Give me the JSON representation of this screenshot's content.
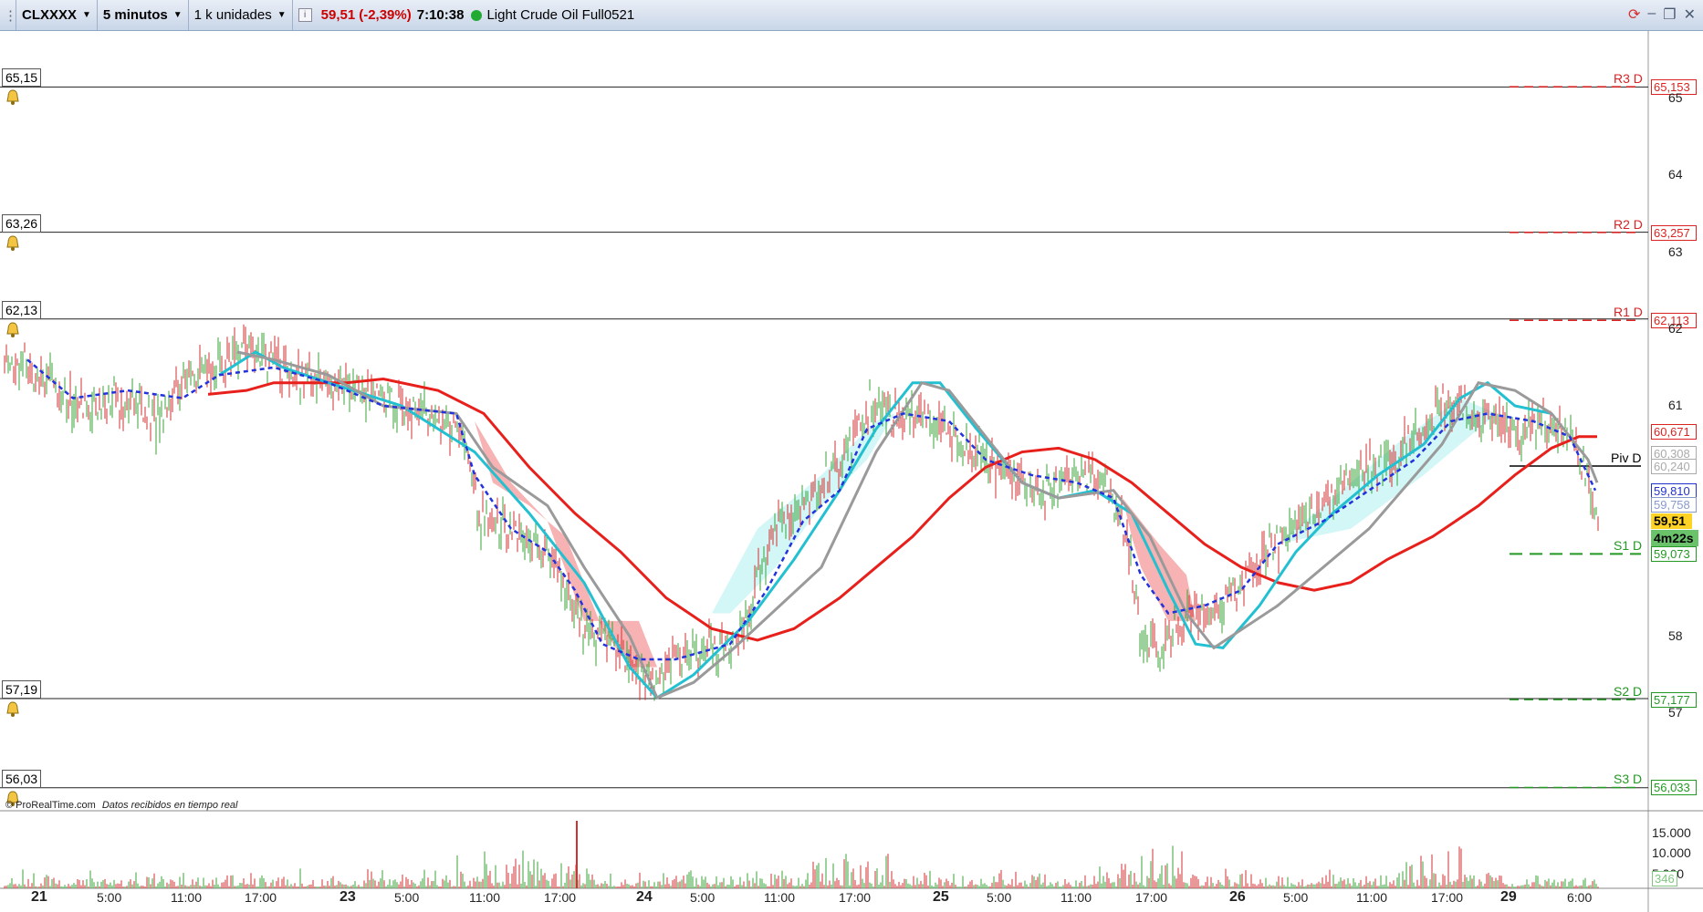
{
  "toolbar": {
    "symbol": "CLXXXX",
    "timeframe": "5 minutos",
    "units": "1 k unidades",
    "info_icon": "info-icon",
    "price": "59,51",
    "change": "(-2,39%)",
    "clock": "7:10:38",
    "instrument": "Light Crude Oil Full0521"
  },
  "window_controls": [
    "sync-icon",
    "minimize-icon",
    "restore-icon",
    "close-icon"
  ],
  "alerts": [
    {
      "label": "65,15",
      "price": 65.15
    },
    {
      "label": "63,26",
      "price": 63.26
    },
    {
      "label": "62,13",
      "price": 62.13
    },
    {
      "label": "57,19",
      "price": 57.19
    },
    {
      "label": "56,03",
      "price": 56.03
    }
  ],
  "pivots": [
    {
      "name": "R3 D",
      "value": "65,153",
      "price": 65.153,
      "color": "#dd2222"
    },
    {
      "name": "R2 D",
      "value": "63,257",
      "price": 63.257,
      "color": "#dd2222"
    },
    {
      "name": "R1 D",
      "value": "62,113",
      "price": 62.113,
      "color": "#dd2222"
    },
    {
      "name": "Piv D",
      "value": "60,217",
      "price": 60.217,
      "color": "#000000"
    },
    {
      "name": "S1 D",
      "value": "59,073",
      "price": 59.073,
      "color": "#229922"
    },
    {
      "name": "S2 D",
      "value": "57,177",
      "price": 57.177,
      "color": "#229922"
    },
    {
      "name": "S3 D",
      "value": "56,033",
      "price": 56.033,
      "color": "#229922"
    }
  ],
  "price_axis": [
    "65",
    "64",
    "63",
    "62",
    "61",
    "58",
    "57"
  ],
  "indicator_values": [
    {
      "value": "60,671",
      "color": "#dd2222"
    },
    {
      "value": "60,308",
      "color": "#aaaaaa"
    },
    {
      "value": "60,240",
      "color": "#aaaaaa"
    },
    {
      "value": "59,810",
      "color": "#2233cc"
    },
    {
      "value": "59,758",
      "color": "#8899cc"
    }
  ],
  "current_price": "59,51",
  "countdown": "4m22s",
  "time_axis": [
    {
      "label": "21",
      "day": true
    },
    {
      "label": "5:00",
      "day": false
    },
    {
      "label": "11:00",
      "day": false
    },
    {
      "label": "17:00",
      "day": false
    },
    {
      "label": "23",
      "day": true
    },
    {
      "label": "5:00",
      "day": false
    },
    {
      "label": "11:00",
      "day": false
    },
    {
      "label": "17:00",
      "day": false
    },
    {
      "label": "24",
      "day": true
    },
    {
      "label": "5:00",
      "day": false
    },
    {
      "label": "11:00",
      "day": false
    },
    {
      "label": "17:00",
      "day": false
    },
    {
      "label": "25",
      "day": true
    },
    {
      "label": "5:00",
      "day": false
    },
    {
      "label": "11:00",
      "day": false
    },
    {
      "label": "17:00",
      "day": false
    },
    {
      "label": "26",
      "day": true
    },
    {
      "label": "5:00",
      "day": false
    },
    {
      "label": "11:00",
      "day": false
    },
    {
      "label": "17:00",
      "day": false
    },
    {
      "label": "29",
      "day": true
    },
    {
      "label": "6:00",
      "day": false
    }
  ],
  "volume_axis": [
    "15.000",
    "10.000",
    "5.000"
  ],
  "volume_last": "346",
  "credit": {
    "source": "© ProRealTime.com",
    "note": "Datos recibidos en tiempo real"
  },
  "colors": {
    "up": "#3aa33a",
    "down": "#d03030",
    "sma_red": "#e8201c",
    "cyan": "#22c0d0",
    "gray": "#9a9a9a",
    "blue_dash": "#2233dd",
    "cloud_red": "#f5a0a0",
    "cloud_cyan": "#c8f4f4"
  }
}
